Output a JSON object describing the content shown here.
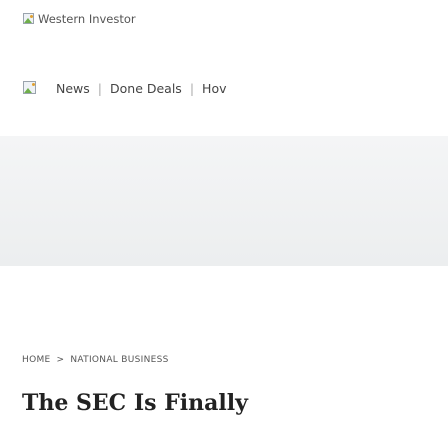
{
  "header": {
    "logo_alt": "Western Investor",
    "logo_icon": "broken-image-icon"
  },
  "nav": {
    "menu_icon": "broken-image-icon",
    "items": [
      {
        "label": "News"
      },
      {
        "label": "Done Deals"
      },
      {
        "label": "Hov"
      }
    ]
  },
  "breadcrumb": {
    "home": "HOME",
    "separator": ">",
    "current": "NATIONAL BUSINESS"
  },
  "article": {
    "title": "The SEC Is Finally"
  }
}
